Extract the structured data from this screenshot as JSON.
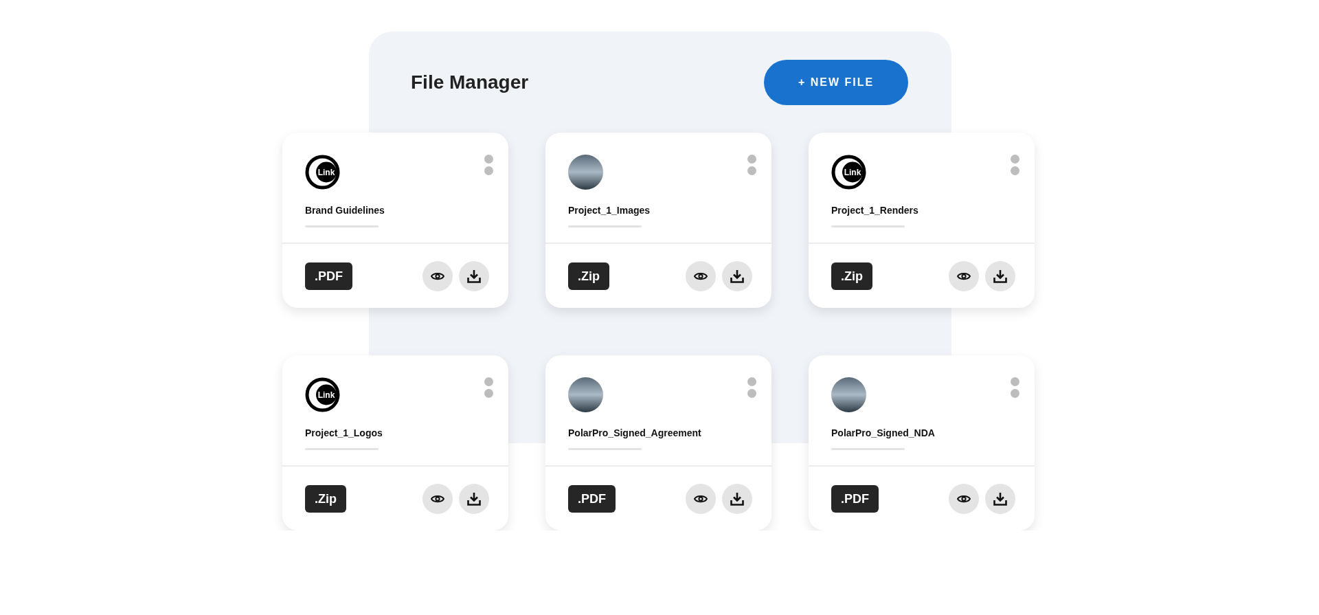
{
  "title": "File Manager",
  "new_file_button": "+ NEW FILE",
  "files": [
    {
      "name": "Brand Guidelines",
      "type": ".PDF",
      "thumbnail": {
        "kind": "logo",
        "text": "Link"
      }
    },
    {
      "name": "Project_1_Images",
      "type": ".Zip",
      "thumbnail": {
        "kind": "photo"
      }
    },
    {
      "name": "Project_1_Renders",
      "type": ".Zip",
      "thumbnail": {
        "kind": "logo",
        "text": "Link"
      }
    },
    {
      "name": "Project_1_Logos",
      "type": ".Zip",
      "thumbnail": {
        "kind": "logo",
        "text": "Link"
      }
    },
    {
      "name": "PolarPro_Signed_Agreement",
      "type": ".PDF",
      "thumbnail": {
        "kind": "photo"
      }
    },
    {
      "name": "PolarPro_Signed_NDA",
      "type": ".PDF",
      "thumbnail": {
        "kind": "photo"
      }
    }
  ]
}
